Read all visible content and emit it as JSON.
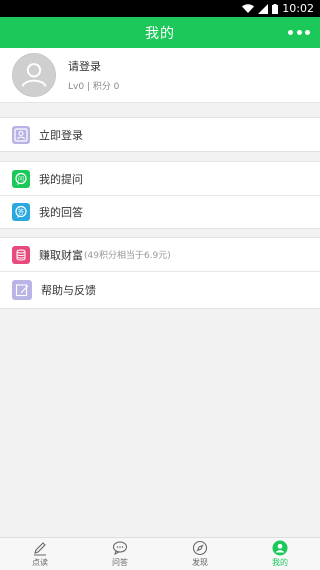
{
  "status_bar": {
    "time": "10:02"
  },
  "header": {
    "title": "我的"
  },
  "profile": {
    "login_prompt": "请登录",
    "level_points": "Lv0 | 积分  0"
  },
  "menu": {
    "login_now": "立即登录",
    "my_questions": "我的提问",
    "my_answers": "我的回答",
    "earn_wealth": "赚取财富",
    "earn_wealth_note": "(49积分相当于6.9元)",
    "help_feedback": "帮助与反馈"
  },
  "tabs": [
    {
      "label": "点读"
    },
    {
      "label": "问答"
    },
    {
      "label": "发现"
    },
    {
      "label": "我的"
    }
  ],
  "colors": {
    "brand_green": "#1dc85a",
    "login_icon": "#b9b4e6",
    "questions_icon": "#1dc85a",
    "answers_icon": "#2aa8e0",
    "wealth_icon": "#e84a7d",
    "help_icon": "#b9b4e6"
  },
  "icons": [
    "wifi-icon",
    "signal-icon",
    "battery-icon",
    "more-icon",
    "avatar-icon",
    "user-card-icon",
    "question-icon",
    "answer-icon",
    "coins-icon",
    "edit-icon",
    "pen-icon",
    "chat-icon",
    "compass-icon",
    "profile-icon"
  ]
}
